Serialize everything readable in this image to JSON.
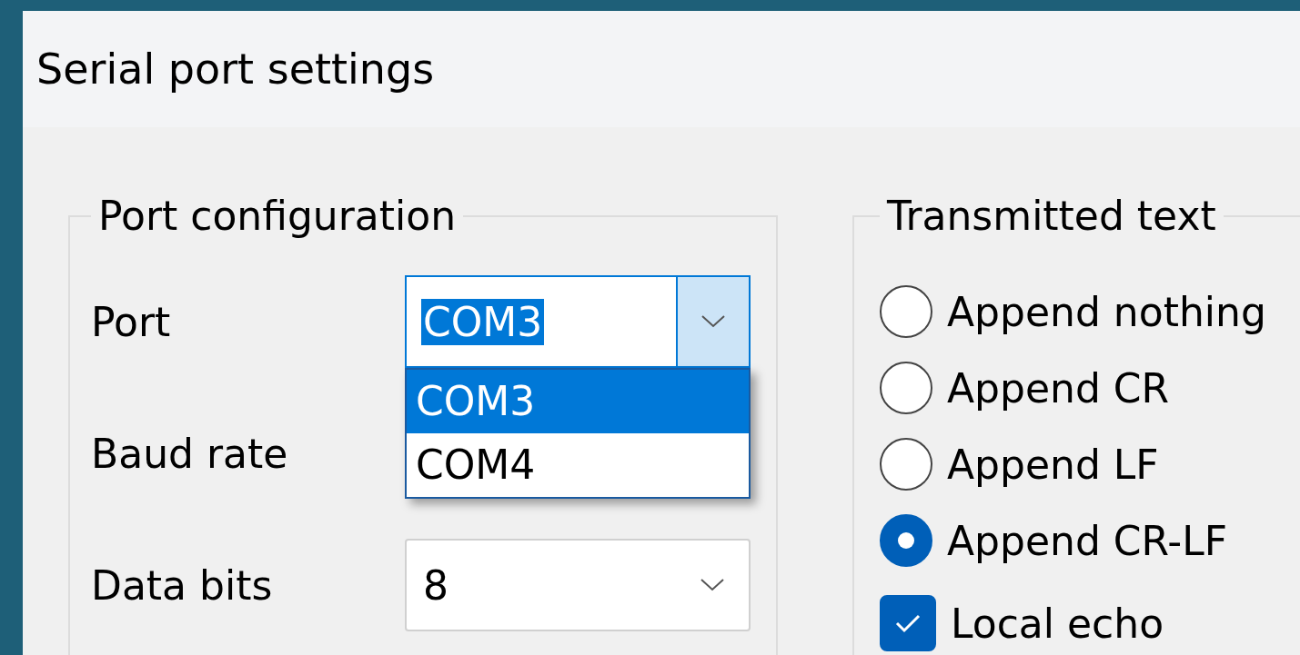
{
  "window": {
    "title": "Serial port settings"
  },
  "port_configuration": {
    "title": "Port configuration",
    "fields": [
      {
        "label": "Port",
        "value": "COM3",
        "focused": true,
        "expanded": true,
        "options": [
          {
            "label": "COM3",
            "selected": true
          },
          {
            "label": "COM4",
            "selected": false
          }
        ]
      },
      {
        "label": "Baud rate"
      },
      {
        "label": "Data bits",
        "value": "8"
      }
    ]
  },
  "transmitted_text": {
    "title": "Transmitted text",
    "options": [
      {
        "label": "Append nothing",
        "selected": false
      },
      {
        "label": "Append CR",
        "selected": false
      },
      {
        "label": "Append LF",
        "selected": false
      },
      {
        "label": "Append CR-LF",
        "selected": true
      }
    ],
    "local_echo": {
      "label": "Local echo",
      "checked": true
    }
  }
}
